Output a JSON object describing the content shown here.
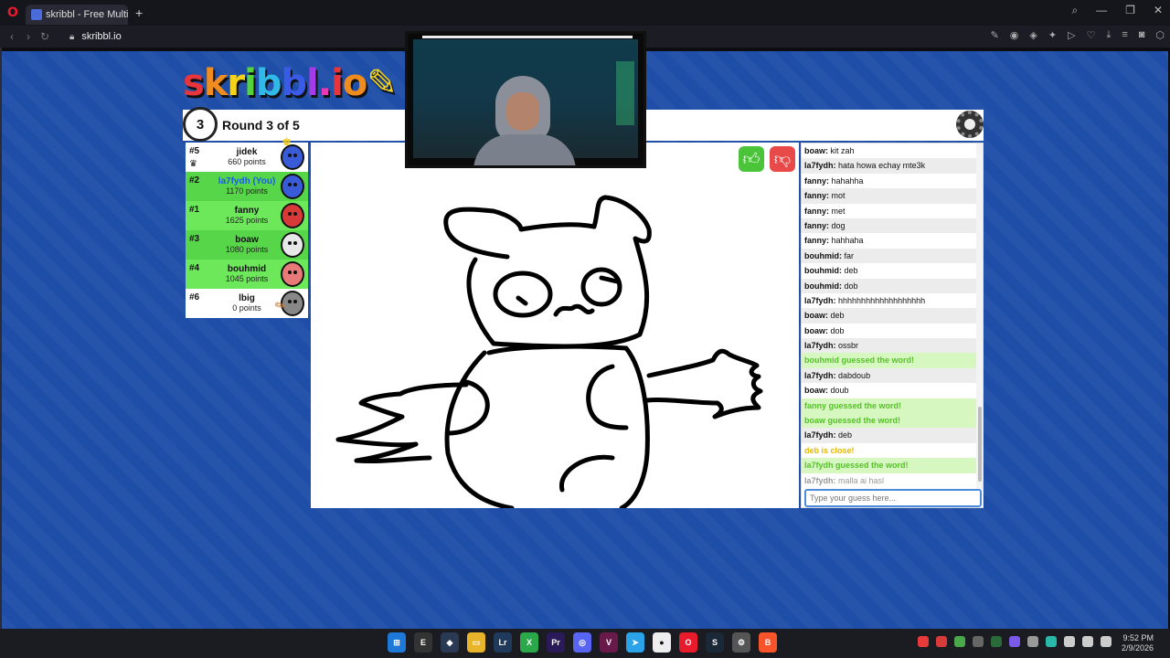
{
  "browser": {
    "tab_title": "skribbl - Free Multipla",
    "url": "skribbl.io"
  },
  "game": {
    "logo": "skribbl.io",
    "round_number": "3",
    "round_label": "Round 3 of 5"
  },
  "players": [
    {
      "rank": "#5",
      "name": "jidek",
      "points": "660 points",
      "color": "#ffffff",
      "avatar": "#3a5bd8",
      "crown": true,
      "owner": true
    },
    {
      "rank": "#2",
      "name": "la7fydh (You)",
      "points": "1170 points",
      "color": "#58d64a",
      "avatar": "#3a5bd8",
      "self": true
    },
    {
      "rank": "#1",
      "name": "fanny",
      "points": "1625 points",
      "color": "#6de85a",
      "avatar": "#d83a3a"
    },
    {
      "rank": "#3",
      "name": "boaw",
      "points": "1080 points",
      "color": "#58d64a",
      "avatar": "#e8e8e8"
    },
    {
      "rank": "#4",
      "name": "bouhmid",
      "points": "1045 points",
      "color": "#6de85a",
      "avatar": "#e87a7a"
    },
    {
      "rank": "#6",
      "name": "lbig",
      "points": "0 points",
      "color": "#ffffff",
      "avatar": "#888888",
      "drawing": true
    }
  ],
  "chat": {
    "messages": [
      {
        "user": "boaw:",
        "text": "kit zah",
        "type": "normal"
      },
      {
        "user": "la7fydh:",
        "text": "hata howa echay mte3k",
        "type": "normal"
      },
      {
        "user": "fanny:",
        "text": "hahahha",
        "type": "normal"
      },
      {
        "user": "fanny:",
        "text": "mot",
        "type": "normal"
      },
      {
        "user": "fanny:",
        "text": "met",
        "type": "normal"
      },
      {
        "user": "fanny:",
        "text": "dog",
        "type": "normal"
      },
      {
        "user": "fanny:",
        "text": "hahhaha",
        "type": "normal"
      },
      {
        "user": "bouhmid:",
        "text": "far",
        "type": "normal"
      },
      {
        "user": "bouhmid:",
        "text": "deb",
        "type": "normal"
      },
      {
        "user": "bouhmid:",
        "text": "dob",
        "type": "normal"
      },
      {
        "user": "la7fydh:",
        "text": "hhhhhhhhhhhhhhhhhhh",
        "type": "normal"
      },
      {
        "user": "boaw:",
        "text": "deb",
        "type": "normal"
      },
      {
        "user": "boaw:",
        "text": "dob",
        "type": "normal"
      },
      {
        "user": "la7fydh:",
        "text": "ossbr",
        "type": "normal"
      },
      {
        "user": "",
        "text": "bouhmid guessed the word!",
        "type": "guess"
      },
      {
        "user": "la7fydh:",
        "text": "dabdoub",
        "type": "normal"
      },
      {
        "user": "boaw:",
        "text": "doub",
        "type": "normal"
      },
      {
        "user": "",
        "text": "fanny guessed the word!",
        "type": "guess"
      },
      {
        "user": "",
        "text": "boaw guessed the word!",
        "type": "guess"
      },
      {
        "user": "la7fydh:",
        "text": "deb",
        "type": "normal"
      },
      {
        "user": "",
        "text": "deb is close!",
        "type": "close"
      },
      {
        "user": "",
        "text": "la7fydh guessed the word!",
        "type": "guess"
      },
      {
        "user": "la7fydh:",
        "text": "malla ai hasl",
        "type": "faded"
      }
    ],
    "input_placeholder": "Type your guess here..."
  },
  "taskbar": {
    "time": "9:52 PM",
    "date": "2/9/2026"
  }
}
